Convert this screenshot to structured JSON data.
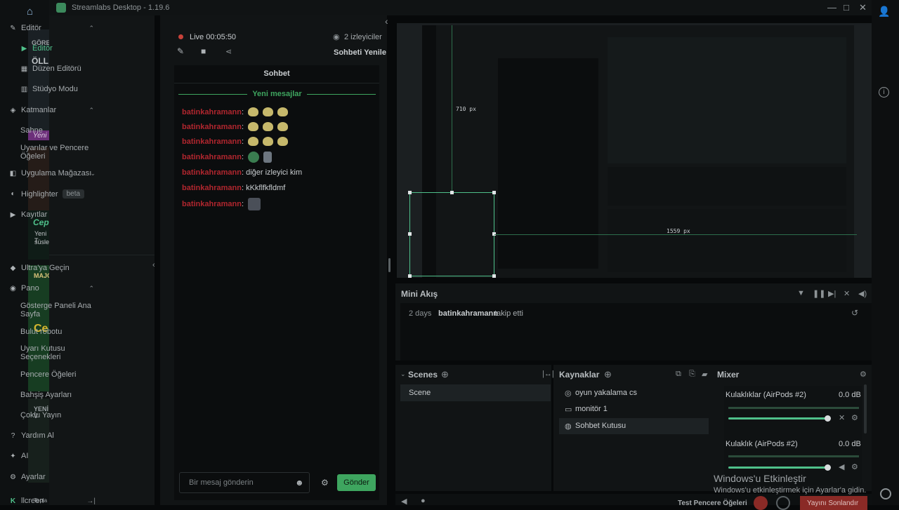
{
  "desktop": {
    "left_labels": [
      "GÖREV",
      "ÖLL",
      "Yeni",
      "Cep",
      "Yeni T",
      "süsle",
      "MAJOR",
      "Ce",
      "YENİ V",
      "Topla"
    ],
    "home_icon": "home-icon",
    "user_icon": "user-icon",
    "info_icon": "info-icon"
  },
  "window": {
    "title": "Streamlabs Desktop - 1.19.6",
    "minimize": "—",
    "maximize": "□",
    "close": "✕"
  },
  "sidebar": {
    "groups": [
      {
        "label": "Editör",
        "icon": "pencil-icon"
      },
      {
        "label": "Katmanlar",
        "icon": "layers-icon"
      },
      {
        "label": "Uygulama Mağazası",
        "icon": "store-icon"
      },
      {
        "label": "Highlighter",
        "icon": "highlighter-icon",
        "badge": "beta"
      },
      {
        "label": "Kayıtlar",
        "icon": "play-icon"
      }
    ],
    "editor_items": [
      "Editör",
      "Düzen Editörü",
      "Stüdyo Modu"
    ],
    "layer_items": [
      "Sahne",
      "Uyarılar ve Pencere Öğeleri"
    ],
    "bottom": [
      {
        "label": "Ultra'ya Geçin",
        "icon": "ultra-icon"
      },
      {
        "label": "Pano",
        "icon": "dashboard-icon"
      }
    ],
    "pano_items": [
      "Gösterge Paneli Ana Sayfa",
      "Bulut robotu",
      "Uyarı Kutusu Seçenekleri",
      "Pencere Öğeleri",
      "Bahşiş Ayarları",
      "Çoklu Yayın"
    ],
    "footer": [
      {
        "label": "Yardım Al",
        "icon": "help-icon"
      },
      {
        "label": "AI",
        "icon": "ai-icon"
      },
      {
        "label": "Ayarlar",
        "icon": "settings-icon"
      }
    ],
    "user": "llcreen",
    "logout_icon": "logout-icon"
  },
  "chat": {
    "live_label": "Live 00:05:50",
    "viewers": "2 izleyiciler",
    "refresh": "Sohbeti Yenile",
    "title": "Sohbet",
    "new_messages": "Yeni mesajlar",
    "messages": [
      {
        "user": "batinkahramann",
        "text": ":",
        "emotes": 3
      },
      {
        "user": "batinkahramann",
        "text": ":",
        "emotes": 3
      },
      {
        "user": "batinkahramann",
        "text": ":",
        "emotes": 3
      },
      {
        "user": "batinkahramann",
        "text": ":",
        "emotes": 2
      },
      {
        "user": "batinkahramann",
        "text": ": diğer izleyici kim",
        "emotes": 0
      },
      {
        "user": "batinkahramann",
        "text": ": kKkflfkfldmf",
        "emotes": 0
      },
      {
        "user": "batinkahramann",
        "text": ":",
        "emotes": 1
      }
    ],
    "input_placeholder": "Bir mesaj gönderin",
    "send": "Gönder"
  },
  "preview": {
    "size_label_1": "710 px",
    "size_label_2": "1559 px"
  },
  "mini_feed": {
    "title": "Mini Akış",
    "time": "2 days",
    "user": "batinkahramann",
    "action": "takip etti"
  },
  "scenes": {
    "title": "Scenes",
    "items": [
      "Scene"
    ]
  },
  "sources": {
    "title": "Kaynaklar",
    "items": [
      {
        "label": "oyun yakalama cs",
        "icon": "gamepad-icon"
      },
      {
        "label": "monitör 1",
        "icon": "monitor-icon"
      },
      {
        "label": "Sohbet Kutusu",
        "icon": "chat-icon"
      }
    ]
  },
  "mixer": {
    "title": "Mixer",
    "channels": [
      {
        "name": "Kulaklıklar (AirPods #2)",
        "db": "0.0 dB",
        "level": 1.0
      },
      {
        "name": "Kulaklık (AirPods #2)",
        "db": "0.0 dB",
        "level": 1.0
      }
    ]
  },
  "status": {
    "test": "Test Pencere Öğeleri",
    "go_live": "Yayını Sonlandır"
  },
  "watermark": {
    "title": "Windows'u Etkinleştir",
    "subtitle": "Windows'u etkinleştirmek için Ayarlar'a gidin."
  },
  "colors": {
    "accent": "#4fc08a",
    "button_green": "#3ea55f",
    "username_red": "#b0262e",
    "live_red": "#c8423a",
    "new_messages": "#3ea55f"
  }
}
